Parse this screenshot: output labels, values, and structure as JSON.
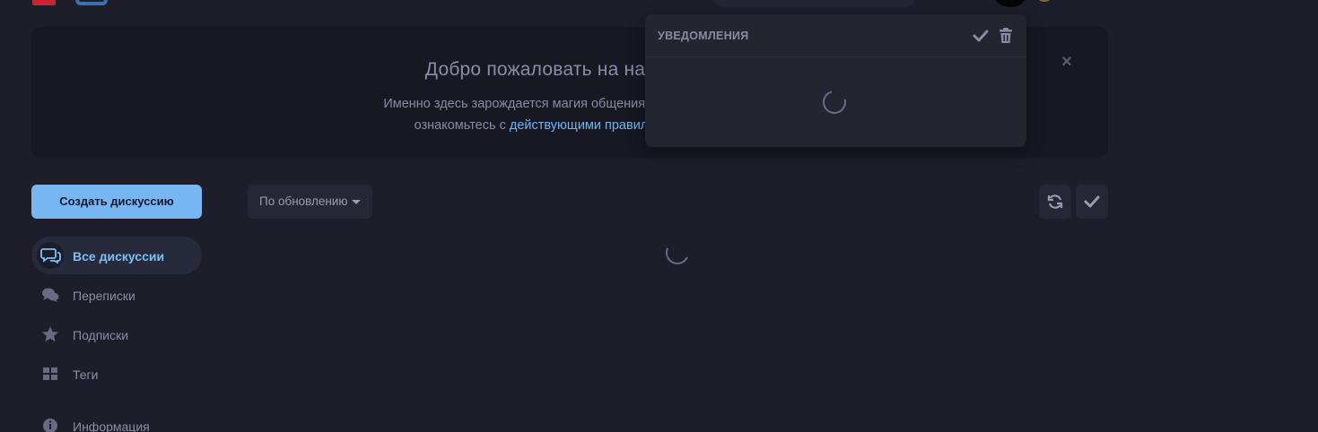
{
  "hero": {
    "title": "Добро пожаловать на наш",
    "text_line1": "Именно здесь зарождается магия общения. Если вы",
    "text_line2_prefix": "ознакомьтесь с ",
    "text_line2_link": "действующими правилами",
    "close_icon": "close-icon"
  },
  "notifications": {
    "title": "УВЕДОМЛЕНИЯ",
    "icons": [
      "check-icon",
      "trash-icon",
      "spinner-icon"
    ]
  },
  "sidebar": {
    "create_button": "Создать дискуссию",
    "items": [
      {
        "label": "Все дискуссии",
        "icon": "comments-icon",
        "active": true
      },
      {
        "label": "Переписки",
        "icon": "chat-icon",
        "active": false
      },
      {
        "label": "Подписки",
        "icon": "star-icon",
        "active": false
      },
      {
        "label": "Теги",
        "icon": "grid-icon",
        "active": false
      },
      {
        "label": "Информация",
        "icon": "info-icon",
        "active": false
      }
    ]
  },
  "toolbar": {
    "sort_label": "По обновлению",
    "refresh_icon": "refresh-icon",
    "mark_read_icon": "check-icon"
  },
  "colors": {
    "background": "#1e1e2a",
    "accent": "#76b6f2",
    "link": "#6fb4f0",
    "panel": "#252532"
  }
}
